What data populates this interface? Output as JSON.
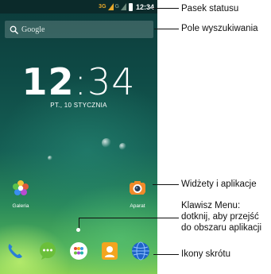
{
  "status_bar": {
    "network_primary": "3G",
    "network_secondary": "G",
    "time": "12:34"
  },
  "search": {
    "text": "Google"
  },
  "clock": {
    "hours": "12",
    "separator": ":",
    "minutes": "34",
    "date": "PT., 10 STYCZNIA"
  },
  "apps": [
    {
      "label": "Galeria",
      "icon": "gallery-flower-icon"
    },
    {
      "label": "Aparat",
      "icon": "camera-icon"
    }
  ],
  "dock": [
    {
      "icon": "phone-icon",
      "color": "#2a7fd6"
    },
    {
      "icon": "messaging-icon",
      "color": "#6bbf3a"
    },
    {
      "icon": "app-drawer-icon",
      "color": "#ffffff"
    },
    {
      "icon": "contacts-icon",
      "color": "#f2a51f"
    },
    {
      "icon": "browser-globe-icon",
      "color": "#1f63c8"
    }
  ],
  "annotations": {
    "status_bar": "Pasek statusu",
    "search_field": "Pole wyszukiwania",
    "widgets": "Widżety i aplikacje",
    "menu_line1": "Klawisz Menu:",
    "menu_line2": "dotknij, aby przejść",
    "menu_line3": "do obszaru aplikacji",
    "shortcuts": "Ikony skrótu"
  },
  "colors": {
    "status_accent": "#e8a82a",
    "wallpaper_dark": "#0c3a3a",
    "wallpaper_light": "#86cf52"
  }
}
